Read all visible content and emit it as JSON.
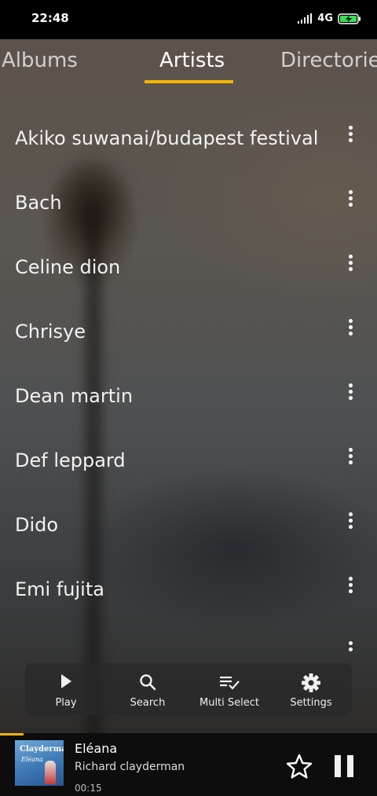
{
  "status_bar": {
    "time": "22:48",
    "network": "4G"
  },
  "tabs": [
    {
      "label": "Albums",
      "active": false
    },
    {
      "label": "Artists",
      "active": true
    },
    {
      "label": "Directories",
      "active": false
    }
  ],
  "artists": [
    "Akiko suwanai/budapest festival",
    "Bach",
    "Celine dion",
    "Chrisye",
    "Dean martin",
    "Def leppard",
    "Dido",
    "Emi fujita"
  ],
  "toolbar": {
    "play_label": "Play",
    "search_label": "Search",
    "multi_select_label": "Multi Select",
    "settings_label": "Settings"
  },
  "now_playing": {
    "title": "Eléana",
    "artist": "Richard clayderman",
    "elapsed": "00:15",
    "album_art_text": "Clayderman",
    "album_art_subtext": "Eléana"
  },
  "colors": {
    "accent": "#f5b300"
  },
  "icons": {
    "play": "play-icon",
    "search": "search-icon",
    "multi_select": "playlist-check-icon",
    "settings": "gear-icon",
    "favorite": "star-outline-icon",
    "pause": "pause-icon",
    "more": "more-vertical-icon"
  }
}
